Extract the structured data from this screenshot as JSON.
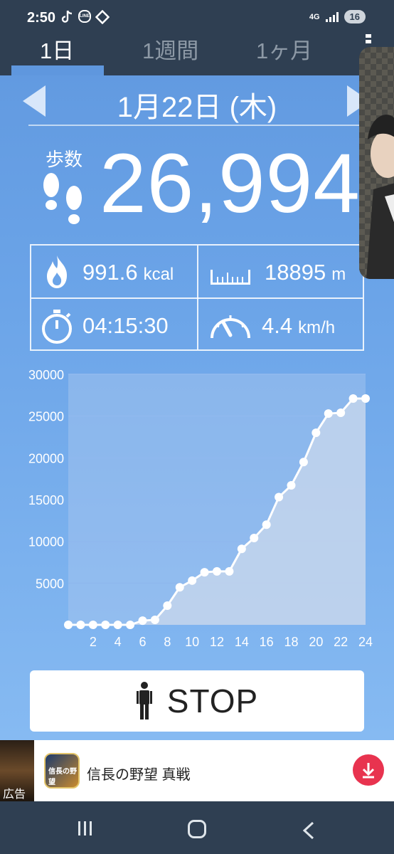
{
  "status_bar": {
    "time": "2:50",
    "network": "4G",
    "battery": "16",
    "left_icons": [
      "tiktok-icon",
      "line-icon",
      "diamond-icon"
    ],
    "line_icon_text": "LINE"
  },
  "tabs": [
    {
      "label": "1日",
      "active": true
    },
    {
      "label": "1週間",
      "active": false
    },
    {
      "label": "1ヶ月",
      "active": false
    }
  ],
  "date": {
    "label": "1月22日 (木)"
  },
  "steps": {
    "label": "歩数",
    "value": "26,994"
  },
  "stats": {
    "calories": {
      "value": "991.6",
      "unit": "kcal",
      "icon": "flame-icon"
    },
    "distance": {
      "value": "18895",
      "unit": "m",
      "icon": "ruler-icon"
    },
    "duration": {
      "value": "04:15:30",
      "icon": "stopwatch-icon"
    },
    "speed": {
      "value": "4.4",
      "unit": "km/h",
      "icon": "speedometer-icon"
    }
  },
  "chart_data": {
    "type": "area",
    "title": "",
    "xlabel": "",
    "ylabel": "",
    "x": [
      0,
      1,
      2,
      3,
      4,
      5,
      6,
      7,
      8,
      9,
      10,
      11,
      12,
      13,
      14,
      15,
      16,
      17,
      18,
      19,
      20,
      21,
      22,
      23,
      24
    ],
    "values": [
      0,
      0,
      0,
      0,
      0,
      0,
      500,
      600,
      2300,
      4500,
      5300,
      6300,
      6400,
      6400,
      9100,
      10400,
      12000,
      15300,
      16700,
      19500,
      23000,
      25300,
      25400,
      27100,
      27100
    ],
    "x_tick_labels": [
      "2",
      "4",
      "6",
      "8",
      "10",
      "12",
      "14",
      "16",
      "18",
      "20",
      "22",
      "24"
    ],
    "y_tick_labels": [
      "5000",
      "10000",
      "15000",
      "20000",
      "25000",
      "30000"
    ],
    "xlim": [
      0,
      24
    ],
    "ylim": [
      0,
      30000
    ],
    "grid": true,
    "colors": {
      "line": "#ffffff",
      "fill": "#c9d8ec",
      "grid": "#8fb8ee"
    }
  },
  "stop_button": {
    "label": "STOP",
    "icon": "person-icon"
  },
  "ad": {
    "badge": "広告",
    "title": "信長の野望 真戦",
    "icon_text": "信長の野望",
    "download_icon": "download-icon"
  },
  "navbar": {
    "items": [
      "recent-apps-icon",
      "home-icon",
      "back-icon"
    ]
  },
  "colors": {
    "header_bg": "#2f3f52",
    "app_bg": "#6ba4e8",
    "accent": "#e8334f"
  }
}
